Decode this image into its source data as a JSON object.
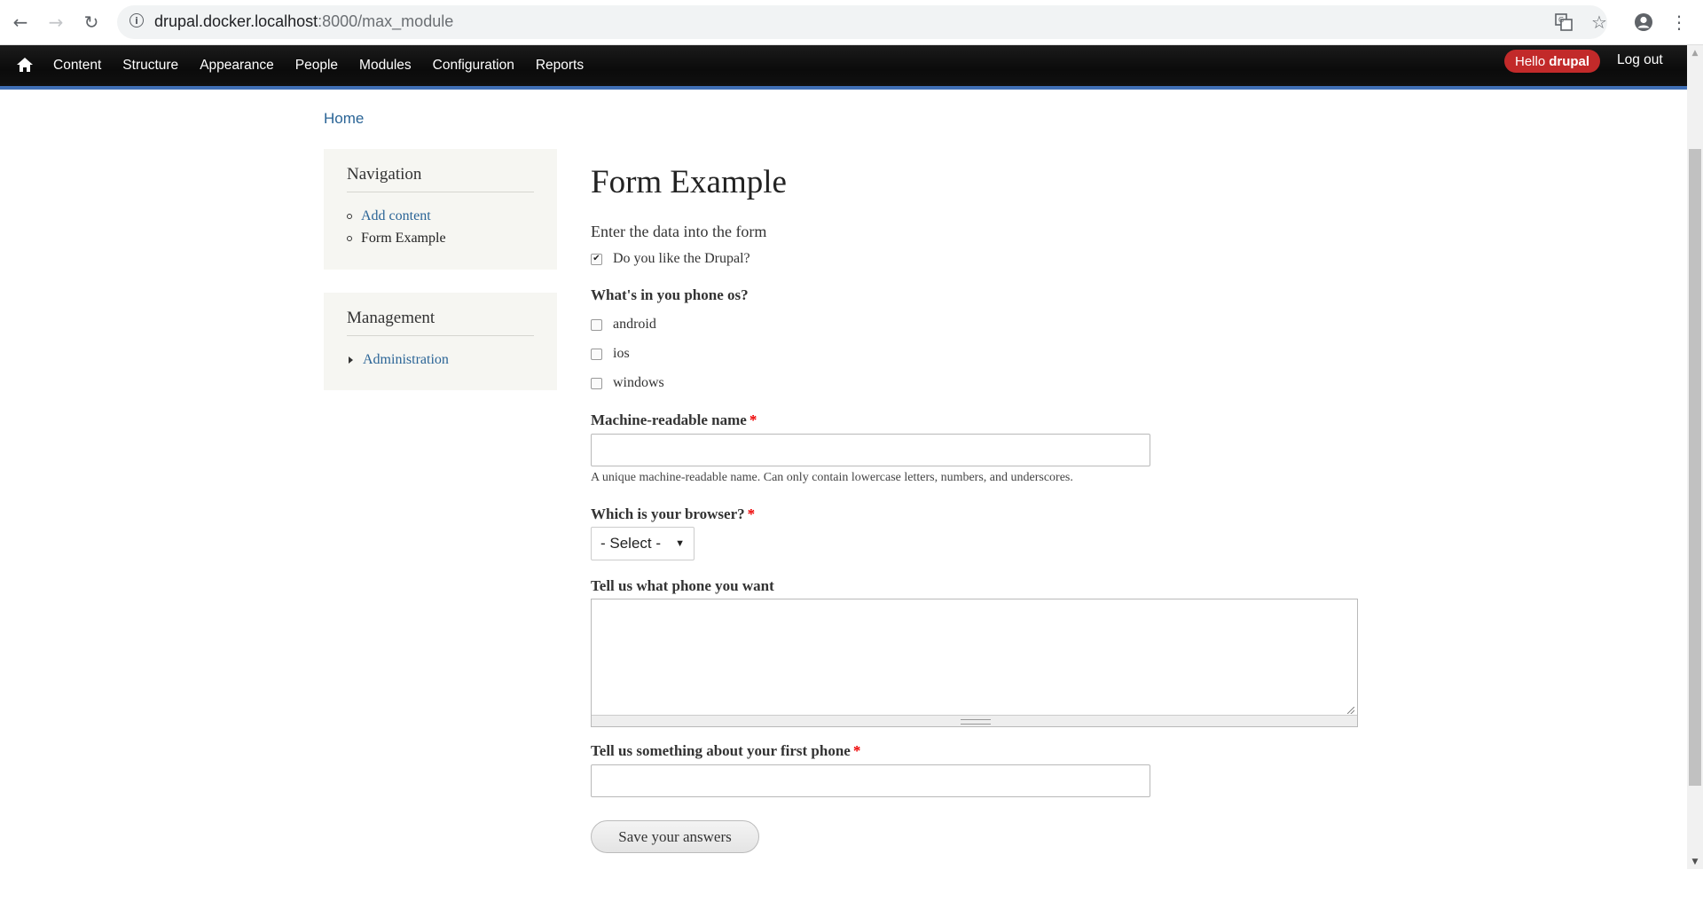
{
  "browser": {
    "url_host": "drupal.docker.localhost",
    "url_rest": ":8000/max_module"
  },
  "toolbar": {
    "menu": [
      "Content",
      "Structure",
      "Appearance",
      "People",
      "Modules",
      "Configuration",
      "Reports"
    ],
    "hello_prefix": "Hello",
    "hello_user": "drupal",
    "logout": "Log out"
  },
  "breadcrumb": "Home",
  "sidebar": {
    "navigation": {
      "title": "Navigation",
      "items": [
        "Add content",
        "Form Example"
      ]
    },
    "management": {
      "title": "Management",
      "items": [
        "Administration"
      ]
    }
  },
  "form": {
    "title": "Form Example",
    "intro": "Enter the data into the form",
    "like_drupal": {
      "label": "Do you like the Drupal?",
      "checked": true
    },
    "phone_os": {
      "label": "What's in you phone os?",
      "options": [
        "android",
        "ios",
        "windows"
      ]
    },
    "machine_name": {
      "label": "Machine-readable name",
      "required_mark": "*",
      "value": "",
      "description": "A unique machine-readable name. Can only contain lowercase letters, numbers, and underscores."
    },
    "browser": {
      "label": "Which is your browser?",
      "required_mark": "*",
      "selected": "- Select -"
    },
    "phone_want": {
      "label": "Tell us what phone you want",
      "value": ""
    },
    "first_phone": {
      "label": "Tell us something about your first phone",
      "required_mark": "*",
      "value": ""
    },
    "submit": "Save your answers"
  },
  "colors": {
    "link": "#2a6496",
    "toolbar_accent": "#3f6fb5",
    "hello_pill": "#c22a2a",
    "required": "#e00000"
  }
}
